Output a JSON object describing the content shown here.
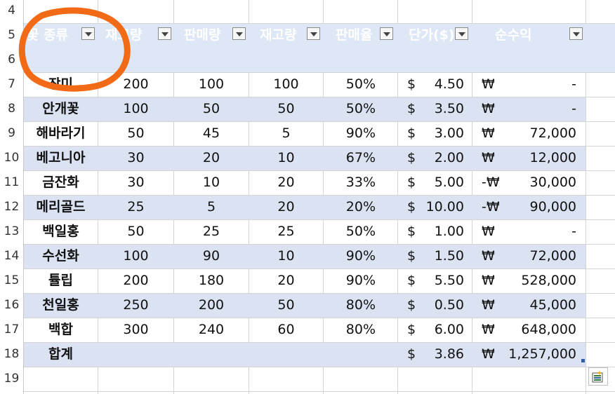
{
  "row_numbers": [
    "4",
    "5",
    "6",
    "7",
    "8",
    "9",
    "10",
    "11",
    "12",
    "13",
    "14",
    "15",
    "16",
    "17",
    "18",
    "19"
  ],
  "headers": [
    "꽃 종류",
    "재고량",
    "판매량",
    "재고량",
    "판매율",
    "단가($)",
    "순수익"
  ],
  "rows": [
    {
      "name": "장미",
      "a": "200",
      "b": "100",
      "c": "100",
      "rate": "50%",
      "usd": "$",
      "price": "4.50",
      "won": "₩",
      "profit": "-"
    },
    {
      "name": "안개꽃",
      "a": "100",
      "b": "50",
      "c": "50",
      "rate": "50%",
      "usd": "$",
      "price": "3.50",
      "won": "₩",
      "profit": "-"
    },
    {
      "name": "해바라기",
      "a": "50",
      "b": "45",
      "c": "5",
      "rate": "90%",
      "usd": "$",
      "price": "3.00",
      "won": "₩",
      "profit": "72,000"
    },
    {
      "name": "베고니아",
      "a": "30",
      "b": "20",
      "c": "10",
      "rate": "67%",
      "usd": "$",
      "price": "2.00",
      "won": "₩",
      "profit": "12,000"
    },
    {
      "name": "금잔화",
      "a": "30",
      "b": "10",
      "c": "20",
      "rate": "33%",
      "usd": "$",
      "price": "5.00",
      "won": "-₩",
      "profit": "30,000"
    },
    {
      "name": "메리골드",
      "a": "25",
      "b": "5",
      "c": "20",
      "rate": "20%",
      "usd": "$",
      "price": "10.00",
      "won": "-₩",
      "profit": "90,000"
    },
    {
      "name": "백일홍",
      "a": "50",
      "b": "25",
      "c": "25",
      "rate": "50%",
      "usd": "$",
      "price": "1.00",
      "won": "₩",
      "profit": "-"
    },
    {
      "name": "수선화",
      "a": "100",
      "b": "90",
      "c": "10",
      "rate": "90%",
      "usd": "$",
      "price": "1.50",
      "won": "₩",
      "profit": "72,000"
    },
    {
      "name": "튤립",
      "a": "200",
      "b": "180",
      "c": "20",
      "rate": "90%",
      "usd": "$",
      "price": "5.50",
      "won": "₩",
      "profit": "528,000"
    },
    {
      "name": "천일홍",
      "a": "250",
      "b": "200",
      "c": "50",
      "rate": "80%",
      "usd": "$",
      "price": "0.50",
      "won": "₩",
      "profit": "45,000"
    },
    {
      "name": "백합",
      "a": "300",
      "b": "240",
      "c": "60",
      "rate": "80%",
      "usd": "$",
      "price": "6.00",
      "won": "₩",
      "profit": "648,000"
    }
  ],
  "total": {
    "name": "합계",
    "usd": "$",
    "price": "3.86",
    "won": "₩",
    "profit": "1,257,000"
  },
  "colors": {
    "band": "#dbe3f3",
    "header_band": "#dde7f5",
    "annotation_circle": "#f36a16",
    "header_text": "#ffffff"
  },
  "icons": {
    "filter": "dropdown-filter-icon",
    "quick_analysis": "quick-analysis-icon"
  }
}
